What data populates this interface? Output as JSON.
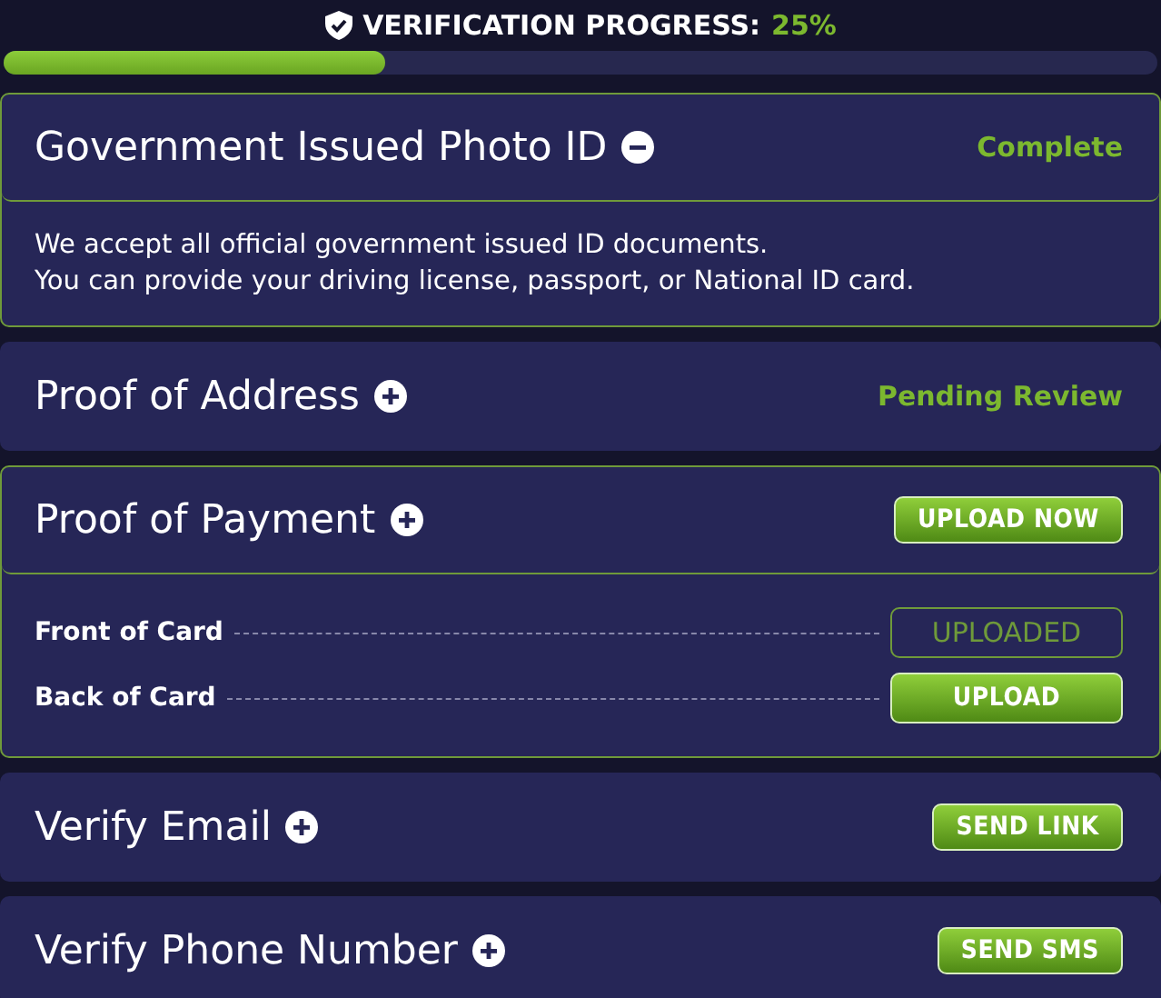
{
  "header": {
    "title": "VERIFICATION PROGRESS:",
    "percent": "25%"
  },
  "progress": {
    "level": 0.33
  },
  "sections": [
    {
      "title": "Government Issued Photo ID",
      "expanded": true,
      "toggle": {
        "kind": "minus"
      },
      "right": {
        "kind": "status",
        "text": "Complete"
      },
      "body": {
        "kind": "text",
        "lines": [
          "We accept all official government issued ID documents.",
          "You can provide your driving license, passport, or National ID card."
        ]
      }
    },
    {
      "title": "Proof of Address",
      "expanded": false,
      "toggle": {
        "kind": "plus"
      },
      "right": {
        "kind": "status",
        "text": "Pending Review"
      }
    },
    {
      "title": "Proof of Payment",
      "expanded": true,
      "toggle": {
        "kind": "plus"
      },
      "right": {
        "kind": "button",
        "text": "UPLOAD NOW"
      },
      "body": {
        "kind": "rows",
        "rows": [
          {
            "label": "Front of Card",
            "action": {
              "kind": "outline",
              "text": "UPLOADED"
            }
          },
          {
            "label": "Back of Card",
            "action": {
              "kind": "solid",
              "text": "UPLOAD"
            }
          }
        ]
      }
    },
    {
      "title": "Verify Email",
      "expanded": false,
      "toggle": {
        "kind": "plus"
      },
      "right": {
        "kind": "button",
        "text": "SEND LINK"
      }
    },
    {
      "title": "Verify Phone Number",
      "expanded": false,
      "toggle": {
        "kind": "plus"
      },
      "right": {
        "kind": "button",
        "text": "SEND SMS"
      }
    }
  ]
}
